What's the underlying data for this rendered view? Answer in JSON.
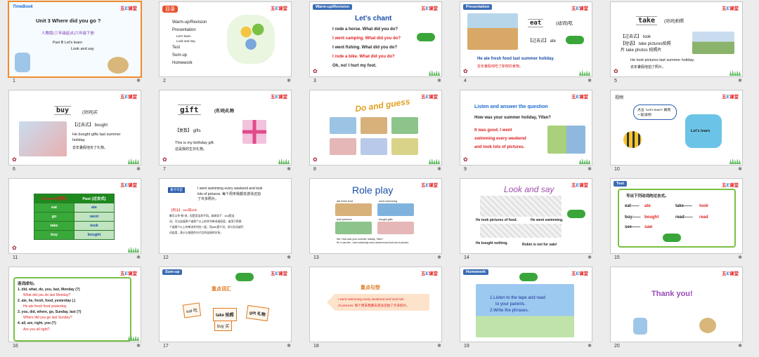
{
  "brand": {
    "a": "五",
    "b": "E",
    "c": "课堂"
  },
  "slides": [
    {
      "num": "1",
      "lines": [
        "Unit 3 Where did you go ?",
        "人教版(三年级起点)六年级下册",
        "Part B   Let's learn",
        "Look and say"
      ],
      "logo": "TimeBook"
    },
    {
      "num": "2",
      "title": "目录",
      "items": [
        "Warm-up/Revision",
        "Presentation",
        "Let's learn",
        "Look and say",
        "Test",
        "Sum-up",
        "Homework"
      ]
    },
    {
      "num": "3",
      "tag": "Warm-up/Revision",
      "title": "Let's chant",
      "lines": [
        "I rode a horse. What did you do?",
        "I went camping. What did you do?",
        "I went fishing. What did you do?",
        "I rode a bike. What did you do?",
        "Oh, no! I hurt my foot."
      ]
    },
    {
      "num": "4",
      "tag": "Presentation",
      "word": "eat",
      "meaning": "(动词)吃",
      "past": "【过去式】 ate",
      "lines": [
        "He ate fresh food last summer holiday.",
        "去年暑假他吃了新鲜的食物。"
      ]
    },
    {
      "num": "5",
      "word": "take",
      "meaning": "(动词)拍照",
      "lines": [
        "【过去式】 took",
        "【短语】 take pictures拍照",
        "片 take photos 拍照片",
        "He took pictures last summer holiday.",
        "去年暑假他拍了照片。"
      ]
    },
    {
      "num": "6",
      "word": "buy",
      "meaning": "(动词)买",
      "lines": [
        "【过去式】 bought",
        "He bought gifts last summer",
        "holiday.",
        "去年暑假他买了礼物。"
      ]
    },
    {
      "num": "7",
      "word": "gift",
      "meaning": "(名词)礼物",
      "lines": [
        "【复数】 gifts",
        "This is my birthday gift.",
        "这是我的生日礼物。"
      ]
    },
    {
      "num": "8",
      "title": "Do and guess"
    },
    {
      "num": "9",
      "title": "Listen and answer the question",
      "question": "How was your summer holiday, Yifan?",
      "lines": [
        "It was good. I went",
        "swimming every weekend",
        "and took lots of pictures."
      ]
    },
    {
      "num": "10",
      "title": "视频",
      "bubble": "点击 \"Let's learn\" 跟我一起读吧!",
      "screen": "Let's learn"
    },
    {
      "num": "11",
      "headers": [
        "Present (原形)",
        "Past (过去式)"
      ],
      "rows": [
        [
          "eat",
          "ate"
        ],
        [
          "go",
          "went"
        ],
        [
          "take",
          "took"
        ],
        [
          "buy",
          "bought"
        ]
      ]
    },
    {
      "num": "12",
      "label": "重点句型",
      "lines": [
        "I went swimming every weekend and took",
        "lots of pictures. 每个周末我都去游泳还拍",
        "了许多照片。",
        "【用法】 and或with",
        "教可以作“和”讲，但是用法却不同。具体如下：and是连",
        "词，可以连接两个或两个以上的并列单词或短语，或用于把两",
        "个或两个以上的单词并列在一起；而with是介词，多与名词或代",
        "词连用，表示与前面的句子后的连接的关系。"
      ]
    },
    {
      "num": "13",
      "title": "Role play",
      "lines": [
        "ate fresh food",
        "went swimming",
        "took pictures",
        "bought gifts",
        "Wu: How was your summer holiday, Yifan?",
        "Mr: It was fine. I went swimming every weekend and took lots of pictures."
      ]
    },
    {
      "num": "14",
      "title": "Look and say",
      "lines": [
        "He took pictures of food.",
        "He went swimming.",
        "He bought nothing.",
        "Robin is not for sale!"
      ]
    },
    {
      "num": "15",
      "tag": "Test",
      "title": "写出下列动词的过去式。",
      "pairs": [
        [
          "eat",
          "ate"
        ],
        [
          "take",
          "took"
        ],
        [
          "buy",
          "bought"
        ],
        [
          "read",
          "read"
        ],
        [
          "see",
          "saw"
        ]
      ]
    },
    {
      "num": "16",
      "title": "连词成句。",
      "lines": [
        "1. did,  what,  do,  you,  last,  Monday  (?)",
        "What did you do last Monday?",
        "2. ate,  he,   fresh,  food,   yesterday   (.)",
        "He ate fresh food yesterday.",
        "3. you,   did,   where,  go,   Sunday,   last   (?)",
        "Where did you go last Sunday?",
        "4. all,    are,    right,   you   (?)",
        "Are you all right?"
      ]
    },
    {
      "num": "17",
      "tag": "Sum-up",
      "title": "重点词汇",
      "cards": [
        "eat 吃",
        "take 拍照",
        "buy 买",
        "gift 礼物"
      ]
    },
    {
      "num": "18",
      "title": "重点句型",
      "lines": [
        "I went swimming every weekend and took lots",
        "of pictures. 每个周末我都去游泳还拍了许多照片。"
      ]
    },
    {
      "num": "19",
      "tag": "Homework",
      "lines": [
        "1.Listen to the tape and read",
        "to your parents.",
        "2.Write the phrases."
      ]
    },
    {
      "num": "20",
      "title": "Thank you!"
    }
  ]
}
